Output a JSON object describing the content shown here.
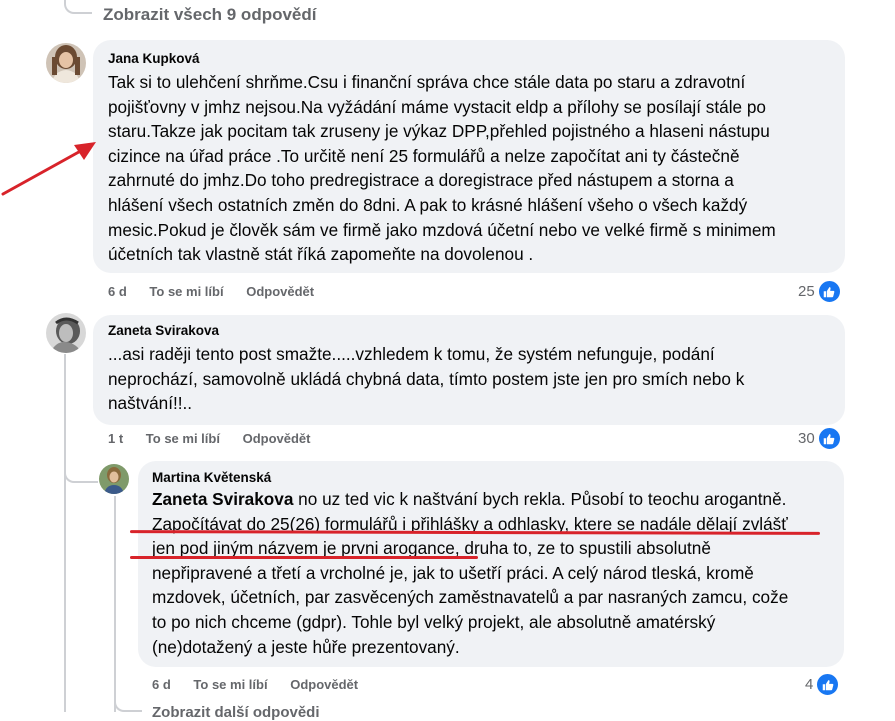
{
  "thread": {
    "view_all_replies": "Zobrazit všech 9 odpovědí",
    "next_partial": "Zobrazit další odpovědi"
  },
  "comments": [
    {
      "author": "Jana Kupková",
      "lines": [
        "Tak si to ulehčení shrňme.Csu i finanční správa chce stále data po staru a zdravotní",
        "pojišťovny v jmhz nejsou.Na vyžádání máme vystacit eldp a přílohy se posílají stále po",
        "staru.Takze jak pocitam tak zruseny je výkaz DPP,přehled pojistného a hlaseni nástupu",
        "cizince na úřad práce .To určitě není 25 formulářů a nelze započítat ani ty částečně",
        "zahrnuté do jmhz.Do toho predregistrace a doregistrace před nástupem a storna a",
        "hlášení všech ostatních změn do 8dni. A pak to krásné hlášení všeho o všech každý",
        "mesic.Pokud je člověk sám ve firmě jako mzdová účetní nebo ve velké firmě s minimem",
        "účetních tak vlastně stát říká zapomeňte na dovolenou ."
      ],
      "time": "6 d",
      "like_label": "To se mi líbí",
      "reply_label": "Odpovědět",
      "reactions": "25"
    },
    {
      "author": "Zaneta Svirakova",
      "lines": [
        "...asi raději tento post smažte.....vzhledem k tomu, že systém nefunguje, podání",
        "neprochází, samovolně ukládá chybná data, tímto postem jste jen pro smích nebo k",
        "naštvání!!.."
      ],
      "time": "1 t",
      "like_label": "To se mi líbí",
      "reply_label": "Odpovědět",
      "reactions": "30"
    },
    {
      "author": "Martina Květenská",
      "mention": "Zaneta Svirakova",
      "first_line_rest": " no uz ted vic k naštvání bych rekla. Působí to teochu arogantně.",
      "lines": [
        "Započítávat do 25(26) formulářů i přihlášky a odhlasky, ktere se nadále dělají zvlášť",
        "jen pod jiným názvem je prvni arogance, druha to, ze to spustili absolutně",
        "nepřipravené a třetí a vrcholné je, jak to ušetří práci. A celý národ tleská, kromě",
        "mzdovek, účetních, par zasvěcených zaměstnavatelů a par nasraných zamcu, cože",
        "to po nich chceme (gdpr). Tohle byl velký projekt, ale absolutně amatérský",
        "(ne)dotažený a jeste hůře prezentovaný."
      ],
      "time": "6 d",
      "like_label": "To se mi líbí",
      "reply_label": "Odpovědět",
      "reactions": "4"
    }
  ],
  "colors": {
    "bubble": "#f0f2f5",
    "meta_text": "#65676b",
    "like_blue": "#1877f2",
    "annotation_red": "#d8232a"
  },
  "icons": [
    "like-icon",
    "thumbs-up-icon",
    "arrow-annotation"
  ]
}
